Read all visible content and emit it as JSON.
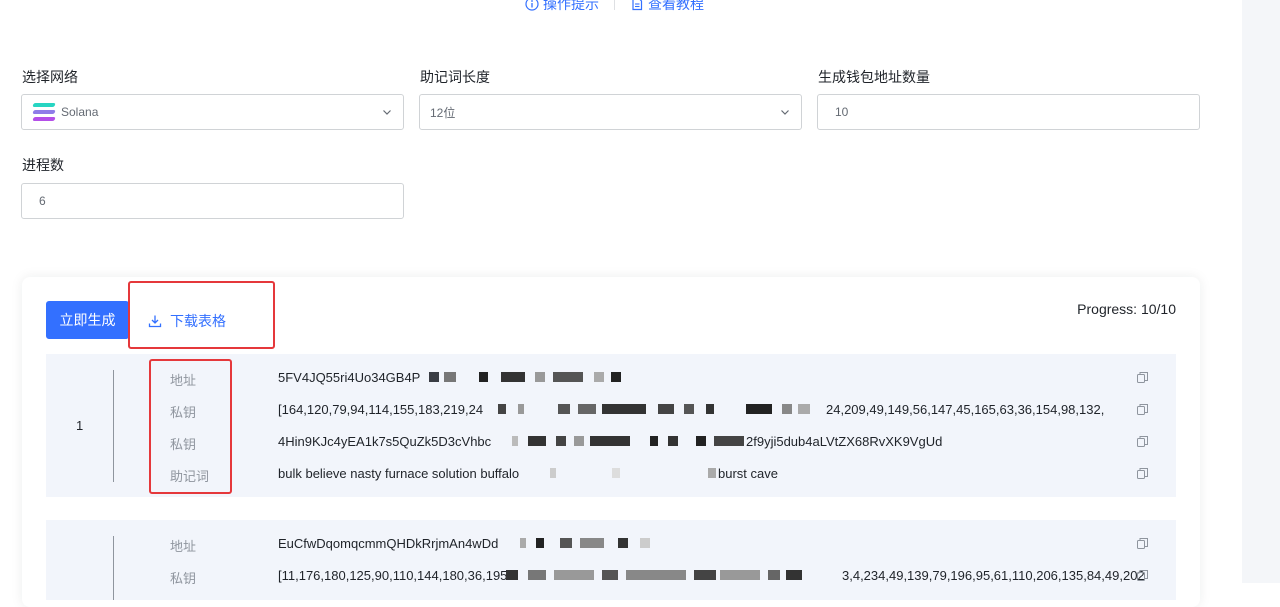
{
  "top_links": {
    "tips": "操作提示",
    "tutorial": "查看教程"
  },
  "form": {
    "network": {
      "label": "选择网络",
      "value": "Solana"
    },
    "mnemonic_length": {
      "label": "助记词长度",
      "value": "12位"
    },
    "wallet_count": {
      "label": "生成钱包地址数量",
      "value": "10"
    },
    "threads": {
      "label": "进程数",
      "value": "6"
    }
  },
  "actions": {
    "generate": "立即生成",
    "download": "下载表格"
  },
  "progress": "Progress: 10/10",
  "results": [
    {
      "index": "1",
      "rows": [
        {
          "label": "地址",
          "value": "5FV4JQ55ri4Uo34GB4P",
          "tail": ""
        },
        {
          "label": "私钥",
          "value": "[164,120,79,94,114,155,183,219,24",
          "tail": "24,209,49,149,56,147,45,165,63,36,154,98,132,"
        },
        {
          "label": "私钥",
          "value": "4Hin9KJc4yEA1k7s5QuZk5D3cVhbc",
          "tail": "2f9yji5dub4aLVtZX68RvXK9VgUd"
        },
        {
          "label": "助记词",
          "value": "bulk believe nasty furnace solution buffalo",
          "tail": "burst cave"
        }
      ]
    },
    {
      "index": "",
      "rows": [
        {
          "label": "地址",
          "value": "EuCfwDqomqcmmQHDkRrjmAn4wDd",
          "tail": ""
        },
        {
          "label": "私钥",
          "value": "[11,176,180,125,90,110,144,180,36,195",
          "tail": "3,4,234,49,139,79,196,95,61,110,206,135,84,49,202"
        }
      ]
    }
  ],
  "colors": {
    "accent": "#3370ff",
    "highlight": "#e5383b",
    "card_bg": "#f2f5fb"
  }
}
